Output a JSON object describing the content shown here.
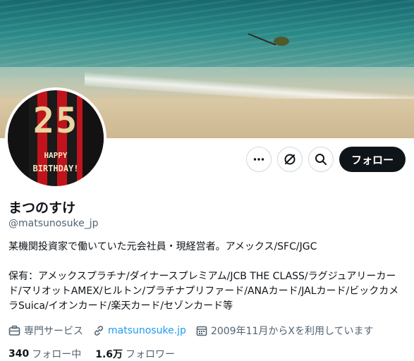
{
  "profile": {
    "avatar": {
      "number": "25",
      "line1": "HAPPY",
      "line2": "BIRTHDAY!"
    },
    "name": "まつのすけ",
    "handle": "@matsunosuke_jp",
    "bio_line1": "某機関投資家で働いていた元会社員・現経営者。アメックス/SFC/JGC",
    "bio_line2": "保有：アメックスプラチナ/ダイナースプレミアム/JCB THE CLASS/ラグジュアリーカード/マリオットAMEX/ヒルトン/プラチナプリファード/ANAカード/JALカード/ビックカメラSuica/イオンカード/楽天カード/セゾンカード等"
  },
  "actions": {
    "more_icon": "more-icon",
    "grok_icon": "grok-icon",
    "search_icon": "search-icon",
    "follow_label": "フォロー"
  },
  "meta": {
    "category": "専門サービス",
    "website": "matsunosuke.jp",
    "joined": "2009年11月からXを利用しています"
  },
  "stats": {
    "following_count": "340",
    "following_label": "フォロー中",
    "followers_count": "1.6万",
    "followers_label": "フォロワー"
  },
  "colors": {
    "accent": "#1d9bf0",
    "text": "#0f1419",
    "secondary": "#536471",
    "follow_bg": "#0f1419"
  }
}
